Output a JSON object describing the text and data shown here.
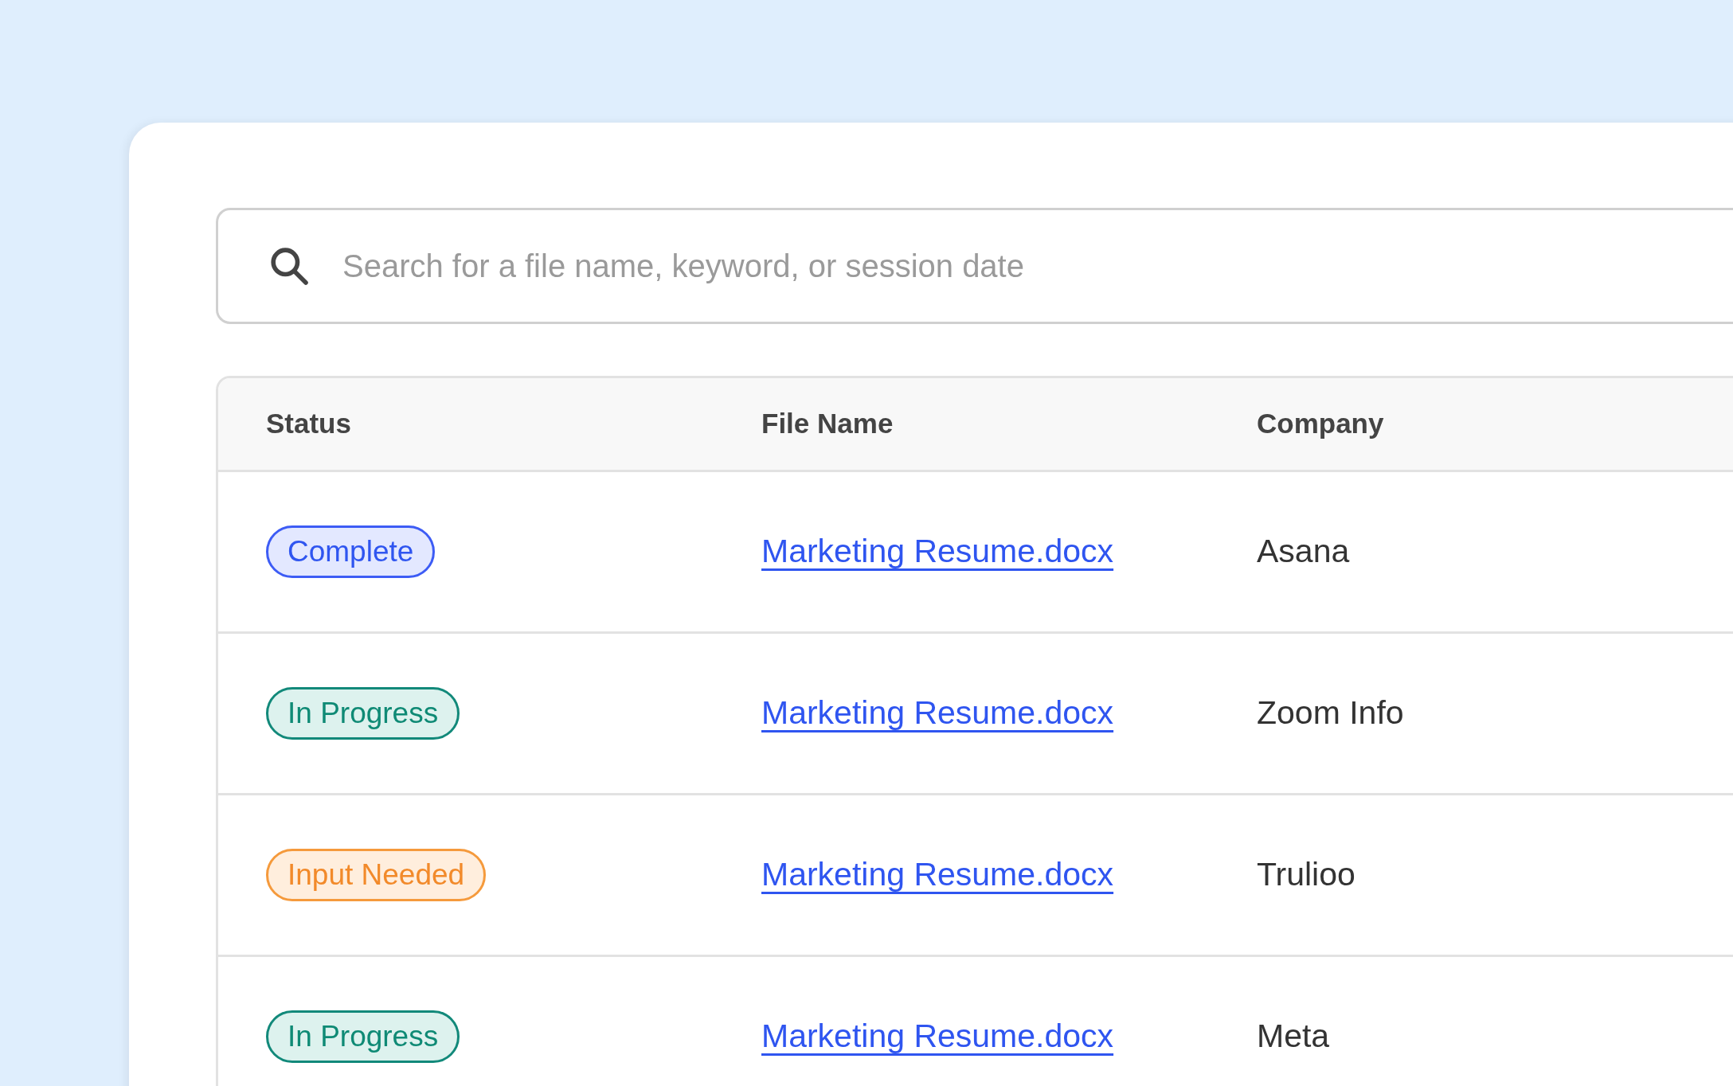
{
  "search": {
    "placeholder": "Search for a file name, keyword, or session date"
  },
  "table": {
    "columns": [
      "Status",
      "File Name",
      "Company"
    ],
    "rows": [
      {
        "status": {
          "label": "Complete",
          "kind": "complete"
        },
        "file_name": "Marketing Resume.docx",
        "company": "Asana"
      },
      {
        "status": {
          "label": "In Progress",
          "kind": "progress"
        },
        "file_name": "Marketing Resume.docx",
        "company": "Zoom Info"
      },
      {
        "status": {
          "label": "Input Needed",
          "kind": "input"
        },
        "file_name": "Marketing Resume.docx",
        "company": "Trulioo"
      },
      {
        "status": {
          "label": "In Progress",
          "kind": "progress"
        },
        "file_name": "Marketing Resume.docx",
        "company": "Meta"
      }
    ]
  }
}
